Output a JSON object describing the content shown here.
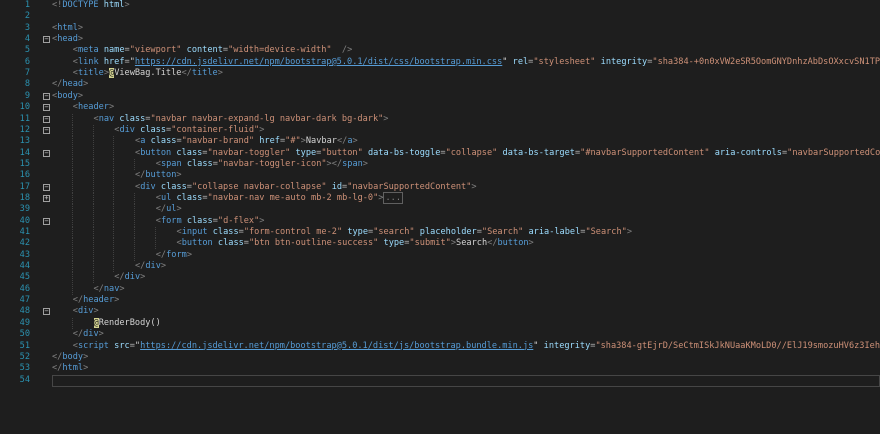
{
  "editor": {
    "lines": [
      {
        "num": "1",
        "fold": "",
        "text": "<!DOCTYPE html>"
      },
      {
        "num": "2",
        "fold": "",
        "text": ""
      },
      {
        "num": "3",
        "fold": "",
        "text": "<html>"
      },
      {
        "num": "4",
        "fold": "-",
        "text": "<head>"
      },
      {
        "num": "5",
        "fold": "",
        "text": "    <meta name=\"viewport\" content=\"width=device-width\" />"
      },
      {
        "num": "6",
        "fold": "",
        "text": "    <link href=\"https://cdn.jsdelivr.net/npm/bootstrap@5.0.1/dist/css/bootstrap.min.css\" rel=\"stylesheet\" integrity=\"sha384-+0n0xVW2eSR5OomGNYDnhzAbDsOXxcvSN1TPprVM"
      },
      {
        "num": "7",
        "fold": "",
        "text": "    <title>@ViewBag.Title</title>"
      },
      {
        "num": "8",
        "fold": "",
        "text": "</head>"
      },
      {
        "num": "9",
        "fold": "-",
        "text": "<body>"
      },
      {
        "num": "10",
        "fold": "-",
        "text": "    <header>"
      },
      {
        "num": "11",
        "fold": "-",
        "text": "        <nav class=\"navbar navbar-expand-lg navbar-dark bg-dark\">"
      },
      {
        "num": "12",
        "fold": "-",
        "text": "            <div class=\"container-fluid\">"
      },
      {
        "num": "13",
        "fold": "",
        "text": "                <a class=\"navbar-brand\" href=\"#\">Navbar</a>"
      },
      {
        "num": "14",
        "fold": "-",
        "text": "                <button class=\"navbar-toggler\" type=\"button\" data-bs-toggle=\"collapse\" data-bs-target=\"#navbarSupportedContent\" aria-controls=\"navbarSupportedConter"
      },
      {
        "num": "15",
        "fold": "",
        "text": "                    <span class=\"navbar-toggler-icon\"></span>"
      },
      {
        "num": "16",
        "fold": "",
        "text": "                </button>"
      },
      {
        "num": "17",
        "fold": "-",
        "text": "                <div class=\"collapse navbar-collapse\" id=\"navbarSupportedContent\">"
      },
      {
        "num": "18",
        "fold": "+",
        "text": "                    <ul class=\"navbar-nav me-auto mb-2 mb-lg-0\">..."
      },
      {
        "num": "39",
        "fold": "",
        "text": "                    </ul>"
      },
      {
        "num": "40",
        "fold": "-",
        "text": "                    <form class=\"d-flex\">"
      },
      {
        "num": "41",
        "fold": "",
        "text": "                        <input class=\"form-control me-2\" type=\"search\" placeholder=\"Search\" aria-label=\"Search\">"
      },
      {
        "num": "42",
        "fold": "",
        "text": "                        <button class=\"btn btn-outline-success\" type=\"submit\">Search</button>"
      },
      {
        "num": "43",
        "fold": "",
        "text": "                    </form>"
      },
      {
        "num": "44",
        "fold": "",
        "text": "                </div>"
      },
      {
        "num": "45",
        "fold": "",
        "text": "            </div>"
      },
      {
        "num": "46",
        "fold": "",
        "text": "        </nav>"
      },
      {
        "num": "47",
        "fold": "",
        "text": "    </header>"
      },
      {
        "num": "48",
        "fold": "-",
        "text": "    <div>"
      },
      {
        "num": "49",
        "fold": "",
        "text": "        @RenderBody()"
      },
      {
        "num": "50",
        "fold": "",
        "text": "    </div>"
      },
      {
        "num": "51",
        "fold": "",
        "text": "    <script src=\"https://cdn.jsdelivr.net/npm/bootstrap@5.0.1/dist/js/bootstrap.bundle.min.js\" integrity=\"sha384-gtEjrD/SeCtmISkJkNUaaKMoLD0//ElJ19smozuHV6z3Iehds+3"
      },
      {
        "num": "52",
        "fold": "",
        "text": "</body>"
      },
      {
        "num": "53",
        "fold": "",
        "text": "</html>"
      },
      {
        "num": "54",
        "fold": "",
        "text": ""
      }
    ]
  },
  "colors": {
    "background": "#1e1e1e",
    "line_number": "#2b91af",
    "tag": "#569cd6",
    "attribute": "#9cdcfe",
    "string": "#ce9178",
    "text": "#d4d4d4",
    "razor_highlight": "#d4d490"
  }
}
